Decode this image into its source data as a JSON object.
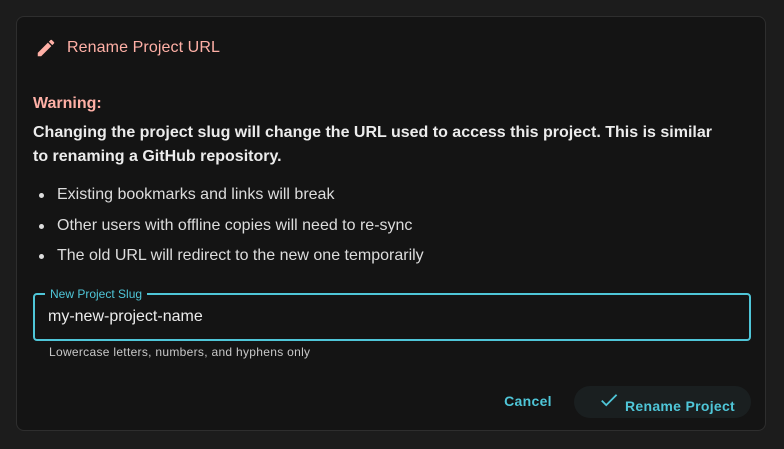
{
  "dialog": {
    "title": "Rename Project URL",
    "title_icon": "pencil-icon",
    "warning_label": "Warning:",
    "warning_text": "Changing the project slug will change the URL used to access this project. This is similar to renaming a GitHub repository.",
    "bullets": [
      "Existing bookmarks and links will break",
      "Other users with offline copies will need to re-sync",
      "The old URL will redirect to the new one temporarily"
    ],
    "field": {
      "label": "New Project Slug",
      "value": "my-new-project-name",
      "helper": "Lowercase letters, numbers, and hyphens only"
    },
    "actions": {
      "cancel_label": "Cancel",
      "confirm_label": "Rename Project",
      "confirm_icon": "check-icon"
    }
  },
  "colors": {
    "accent": "#4fc6d8",
    "warning": "#ffb0a6",
    "surface": "#141414",
    "background": "#1c1c1c"
  }
}
